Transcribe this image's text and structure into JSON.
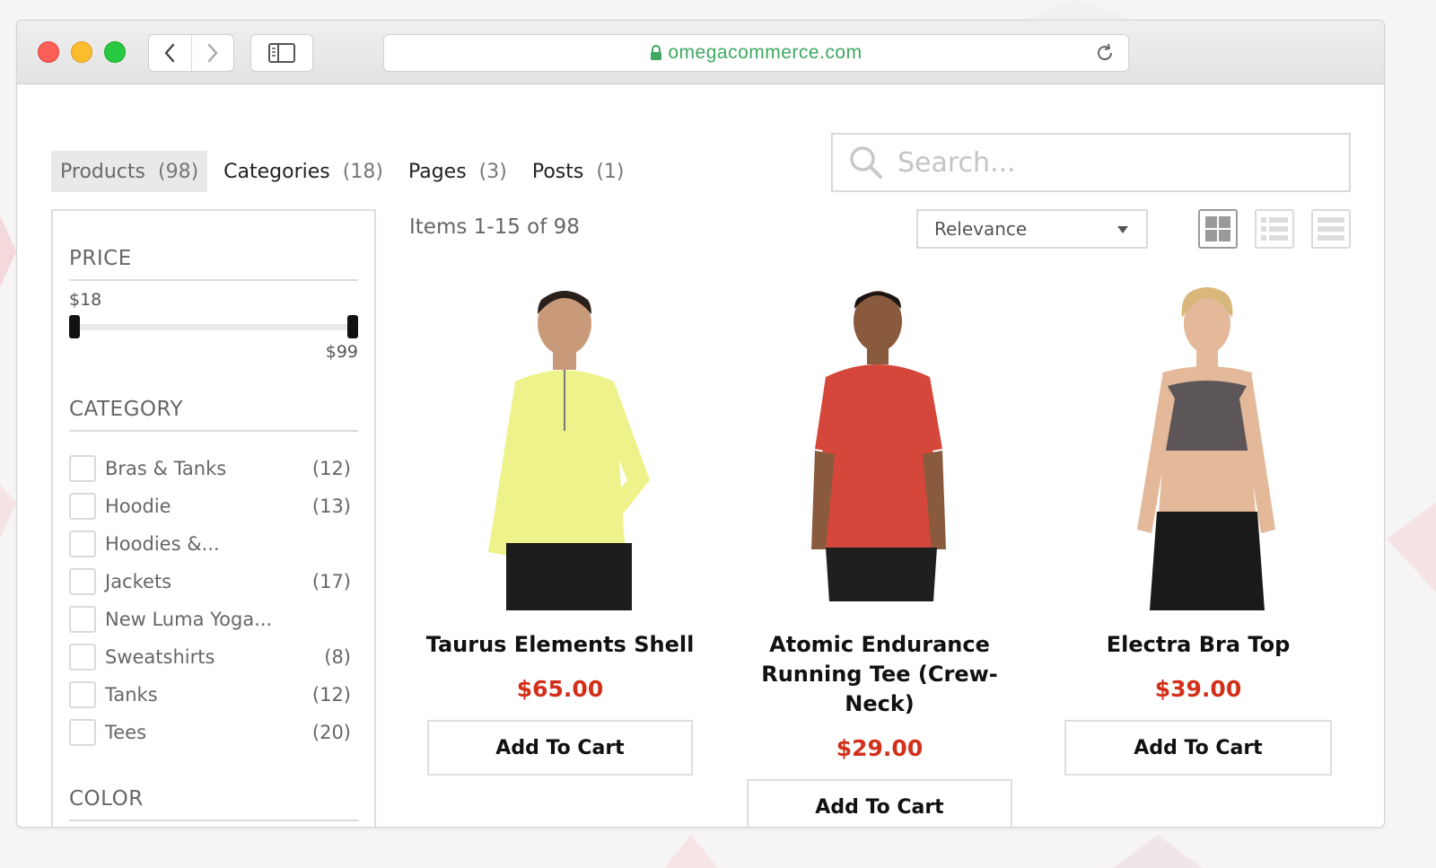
{
  "browser": {
    "url": "omegacommerce.com"
  },
  "tabs": [
    {
      "label": "Products",
      "count": "(98)"
    },
    {
      "label": "Categories",
      "count": "(18)"
    },
    {
      "label": "Pages",
      "count": "(3)"
    },
    {
      "label": "Posts",
      "count": "(1)"
    }
  ],
  "search": {
    "placeholder": "Search...",
    "value": ""
  },
  "filters": {
    "price": {
      "heading": "PRICE",
      "min_label": "$18",
      "max_label": "$99",
      "selected_min": 18,
      "selected_max": 99
    },
    "category": {
      "heading": "CATEGORY",
      "items": [
        {
          "label": "Bras & Tanks",
          "count": "(12)"
        },
        {
          "label": "Hoodie",
          "count": "(13)"
        },
        {
          "label": "Hoodies &...",
          "count": ""
        },
        {
          "label": "Jackets",
          "count": "(17)"
        },
        {
          "label": "New Luma Yoga...",
          "count": ""
        },
        {
          "label": "Sweatshirts",
          "count": "(8)"
        },
        {
          "label": "Tanks",
          "count": "(12)"
        },
        {
          "label": "Tees",
          "count": "(20)"
        }
      ]
    },
    "color": {
      "heading": "COLOR"
    }
  },
  "toolbar": {
    "items_count": "Items 1-15 of 98",
    "sort_selected": "Relevance",
    "view_modes": [
      "grid-view-icon",
      "list-view-icon",
      "table-view-icon"
    ],
    "active_view": "grid-view-icon"
  },
  "products": [
    {
      "name": "Taurus Elements Shell",
      "price": "$65.00",
      "button": "Add To Cart",
      "shirt_color": "#eef28a"
    },
    {
      "name": "Atomic Endurance Running Tee (Crew-Neck)",
      "price": "$29.00",
      "button": "Add To Cart",
      "shirt_color": "#d4473a"
    },
    {
      "name": "Electra Bra Top",
      "price": "$39.00",
      "button": "Add To Cart",
      "shirt_color": "#5c5659"
    }
  ],
  "colors": {
    "price": "#d2301a",
    "url": "#3ea860"
  }
}
